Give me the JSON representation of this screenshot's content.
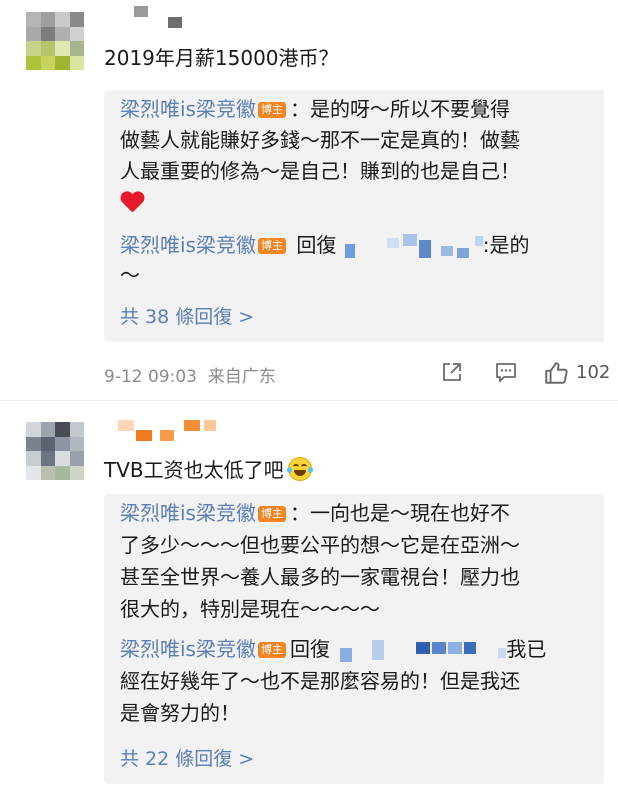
{
  "comments": [
    {
      "text": "2019年月薪15000港币？",
      "replies": [
        {
          "author": "梁烈唯is梁竞徽",
          "badge": "博主",
          "lines": [
            "：是的呀～所以不要覺得",
            "做藝人就能賺好多錢～那不一定是真的！做藝",
            "人最重要的修為～是自己！賺到的也是自己！"
          ],
          "has_heart": true
        },
        {
          "author": "梁烈唯is梁竞徽",
          "badge": "博主",
          "prefix": "回復",
          "tail": ":是的",
          "lines": [
            "～"
          ]
        }
      ],
      "more_label": "共 38 條回復 >",
      "time": "9-12 09:03",
      "location": "来自广东",
      "likes": "102"
    },
    {
      "text": "TVB工资也太低了吧",
      "replies": [
        {
          "author": "梁烈唯is梁竞徽",
          "badge": "博主",
          "lines": [
            "：一向也是～現在也好不",
            "了多少～～～但也要公平的想～它是在亞洲～",
            "甚至全世界～養人最多的一家電視台！壓力也",
            "很大的，特別是現在～～～～"
          ]
        },
        {
          "author": "梁烈唯is梁竞徽",
          "badge": "博主",
          "prefix": "回復",
          "tail": "我已",
          "lines": [
            "經在好幾年了～也不是那麼容易的！但是我还",
            "是會努力的！"
          ]
        }
      ],
      "more_label": "共 22 條回復 >"
    }
  ],
  "icons": [
    "share-icon",
    "comment-icon",
    "thumbs-up-icon",
    "heart-emoji-icon",
    "laugh-cry-emoji-icon"
  ],
  "colors": {
    "author": "#5b7fb5",
    "badge": "#f08522",
    "reply_bg": "#f2f2f2",
    "meta": "#8c8c8c"
  }
}
